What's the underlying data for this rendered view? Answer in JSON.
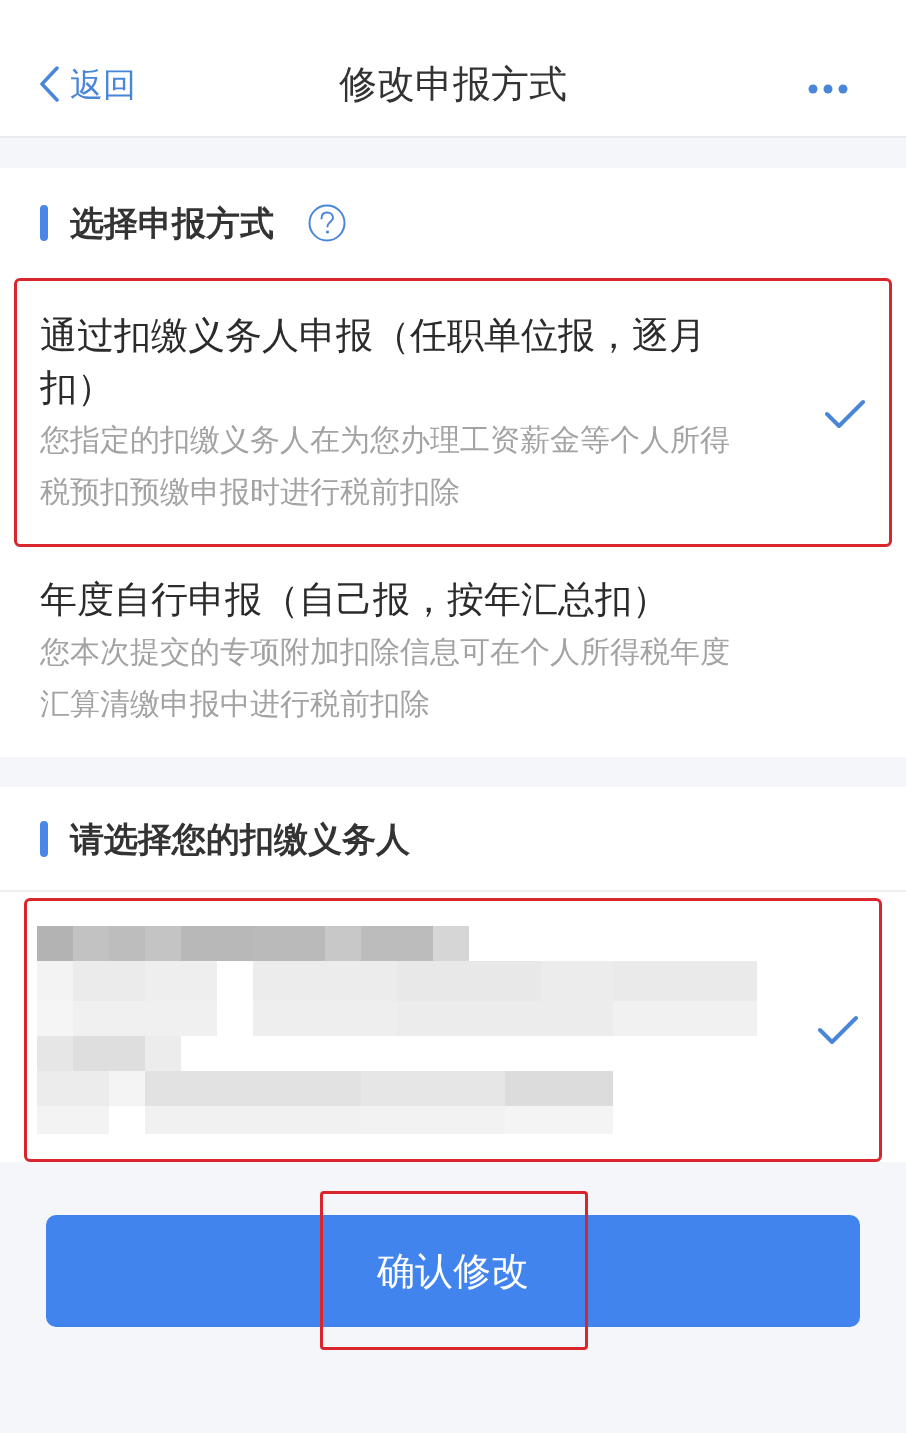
{
  "header": {
    "back_label": "返回",
    "title": "修改申报方式"
  },
  "method_section": {
    "heading": "选择申报方式",
    "options": [
      {
        "title": "通过扣缴义务人申报（任职单位报，逐月扣）",
        "description": "您指定的扣缴义务人在为您办理工资薪金等个人所得税预扣预缴申报时进行税前扣除",
        "selected": true,
        "highlighted": true
      },
      {
        "title": "年度自行申报（自己报，按年汇总扣）",
        "description": "您本次提交的专项附加扣除信息可在个人所得税年度汇算清缴申报中进行税前扣除",
        "selected": false,
        "highlighted": false
      }
    ]
  },
  "agent_section": {
    "heading": "请选择您的扣缴义务人",
    "agents": [
      {
        "redacted": true,
        "selected": true,
        "highlighted": true
      }
    ]
  },
  "confirm_button": {
    "label": "确认修改",
    "highlighted": true
  }
}
